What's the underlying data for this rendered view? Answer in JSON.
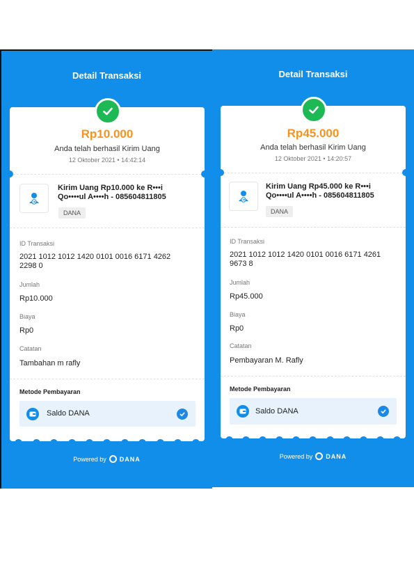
{
  "left": {
    "header": "Detail Transaksi",
    "amount": "Rp10.000",
    "subtitle": "Anda telah berhasil Kirim Uang",
    "datetime": "12 Oktober 2021 • 14:42:14",
    "tx_line1": "Kirim Uang Rp10.000 ke R•••i",
    "tx_line2": "Qo••••ul A••••h - 085604811805",
    "tag": "DANA",
    "id_label": "ID Transaksi",
    "id_line1": "2021 1012 1012 1420 0101 0016 6171 4262",
    "id_line2": "2298 0",
    "jumlah_label": "Jumlah",
    "jumlah_value": "Rp10.000",
    "biaya_label": "Biaya",
    "biaya_value": "Rp0",
    "catatan_label": "Catatan",
    "catatan_value": "Tambahan m rafly",
    "method_title": "Metode Pembayaran",
    "method_value": "Saldo DANA",
    "powered": "Powered by",
    "brand": "DANA"
  },
  "right": {
    "header": "Detail Transaksi",
    "amount": "Rp45.000",
    "subtitle": "Anda telah berhasil Kirim Uang",
    "datetime": "12 Oktober 2021 • 14:20:57",
    "tx_line1": "Kirim Uang Rp45.000 ke R•••i",
    "tx_line2": "Qo••••ul A••••h - 085604811805",
    "tag": "DANA",
    "id_label": "ID Transaksi",
    "id_line1": "2021 1012 1012 1420 0101 0016 6171 4261",
    "id_line2": "9673 8",
    "jumlah_label": "Jumlah",
    "jumlah_value": "Rp45.000",
    "biaya_label": "Biaya",
    "biaya_value": "Rp0",
    "catatan_label": "Catatan",
    "catatan_value": "Pembayaran M. Rafly",
    "method_title": "Metode Pembayaran",
    "method_value": "Saldo DANA",
    "powered": "Powered by",
    "brand": "DANA"
  },
  "colors": {
    "brand_blue": "#118EEA",
    "amount_orange": "#F7931E",
    "success_green": "#1DB954"
  }
}
